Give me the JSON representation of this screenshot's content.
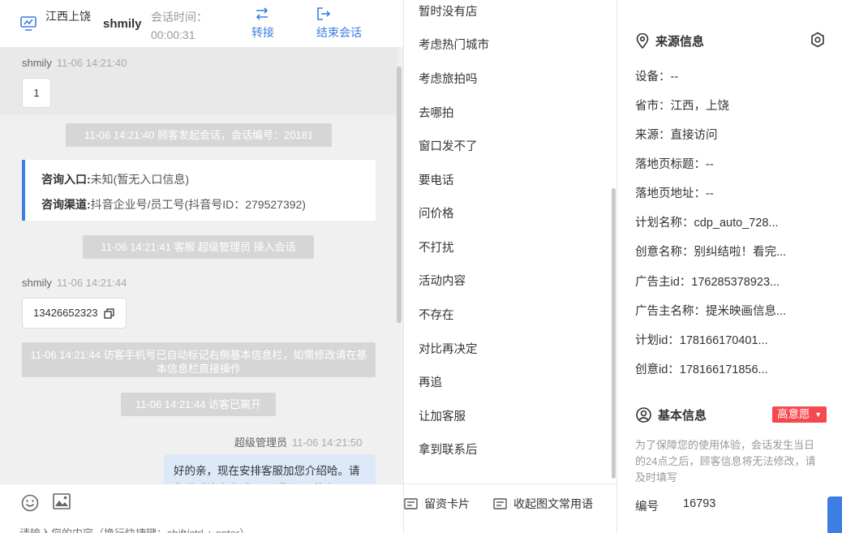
{
  "chat": {
    "header": {
      "location": "江西上饶",
      "username": "shmily",
      "session_time_label": "会话时间：",
      "session_time": "00:00:31",
      "transfer_label": "转接",
      "end_label": "结束会话"
    },
    "messages": {
      "m1_sender": "shmily",
      "m1_time": "11-06 14:21:40",
      "m1_text": "1",
      "sys1": "11-06 14:21:40 顾客发起会话，会话编号：20181",
      "card_entry_label": "咨询入口:",
      "card_entry_value": "未知(暂无入口信息)",
      "card_channel_label": "咨询渠道:",
      "card_channel_value": "抖音企业号/员工号(抖音号ID：279527392)",
      "sys2": "11-06 14:21:41 客服 超级管理员 接入会话",
      "m2_sender": "shmily",
      "m2_time": "11-06 14:21:44",
      "m2_text": "13426652323",
      "sys3": "11-06 14:21:44 访客手机号已自动标记右侧基本信息栏，如需修改请在基本信息栏直接操作",
      "sys4": "11-06 14:21:44 访客已离开",
      "m3_sender": "超级管理员",
      "m3_time": "11-06 14:21:50",
      "m3_text": "好的亲，现在安排客服加您介绍哈。请您稍后注意查看，下\"通讯录\"若点"
    },
    "input_placeholder": "请输入您的内容（换行快捷键：shift/ctrl + enter）"
  },
  "quick_replies": {
    "items": [
      "暂时没有店",
      "考虑热门城市",
      "考虑旅拍吗",
      "去哪拍",
      "窗口发不了",
      "要电话",
      "问价格",
      "不打扰",
      "活动内容",
      "不存在",
      "对比再决定",
      "再追",
      "让加客服",
      "拿到联系后"
    ],
    "footer_card_label": "留资卡片",
    "footer_phrases_label": "收起图文常用语"
  },
  "info": {
    "source_title": "来源信息",
    "rows": [
      "设备：--",
      "省市：江西，上饶",
      "来源：直接访问",
      "落地页标题：--",
      "落地页地址：--",
      "计划名称：cdp_auto_728...",
      "创意名称：别纠结啦！看完...",
      "广告主id：176285378923...",
      "广告主名称：提米映画信息...",
      "计划id：178166170401...",
      "创意id：178166171856..."
    ],
    "basic_title": "基本信息",
    "intent_badge": "高意愿",
    "note": "为了保障您的使用体验，会话发生当日的24点之后，顾客信息将无法修改，请及时填写",
    "id_label": "编号",
    "id_value": "16793"
  },
  "colors": {
    "accent": "#3d7ee3",
    "badge": "#f5484f",
    "system": "#d6d6d6",
    "agent_bubble": "#dde9f9"
  }
}
